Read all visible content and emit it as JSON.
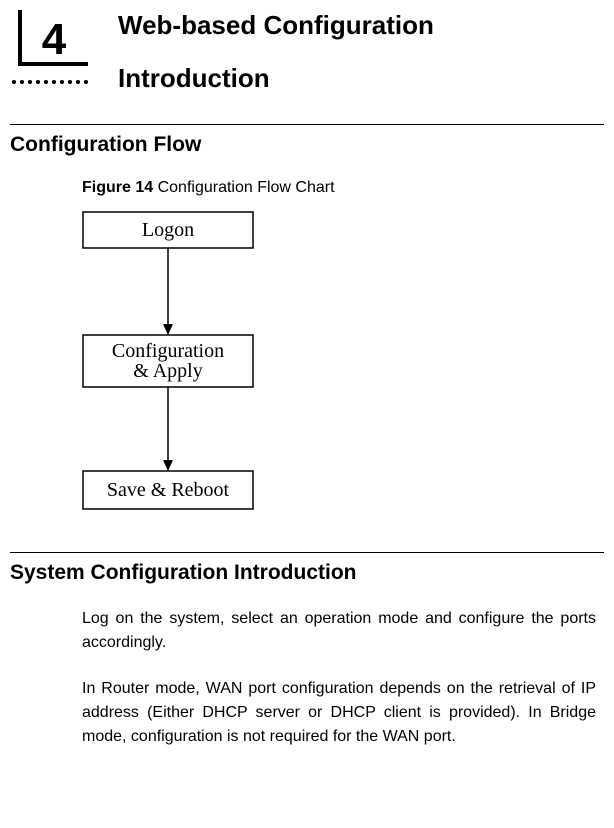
{
  "chapter": {
    "number": "4",
    "title": "Web-based Configuration",
    "subtitle": "Introduction"
  },
  "section1": {
    "heading": "Configuration Flow",
    "figure_label_prefix": "Figure 14",
    "figure_label_rest": " Configuration Flow Chart"
  },
  "chart_data": {
    "type": "diagram",
    "nodes": [
      {
        "id": "logon",
        "label": "Logon"
      },
      {
        "id": "config",
        "label_line1": "Configuration",
        "label_line2": "& Apply"
      },
      {
        "id": "save",
        "label": "Save & Reboot"
      }
    ],
    "edges": [
      {
        "from": "logon",
        "to": "config"
      },
      {
        "from": "config",
        "to": "save"
      }
    ]
  },
  "section2": {
    "heading": "System Configuration Introduction",
    "paragraph1": "Log on the system, select an operation mode and configure the ports accordingly.",
    "paragraph2": "In Router mode, WAN port configuration depends on the retrieval of IP address (Either DHCP server or DHCP client is provided). In Bridge mode, configuration is not required for the WAN port."
  }
}
